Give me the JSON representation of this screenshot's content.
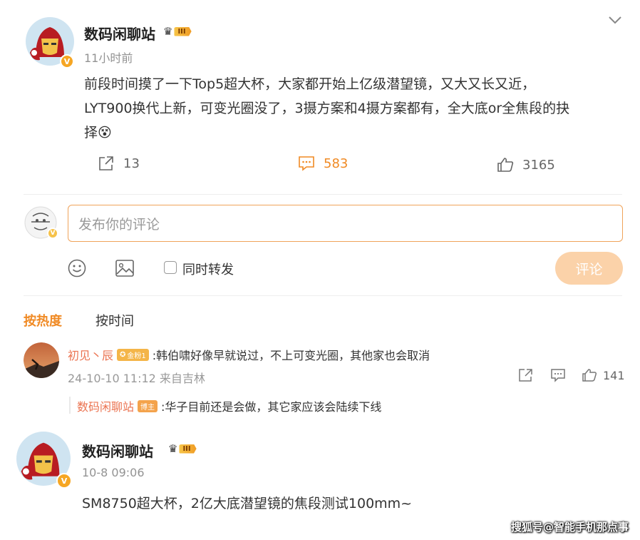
{
  "post1": {
    "author": "数码闲聊站",
    "level": "III",
    "time": "11小时前",
    "content_lines": [
      "前段时间摸了一下Top5超大杯，大家都开始上亿级潜望镜，又大又长又近，",
      "LYT900换代上新，可变光圈没了，3摄方案和4摄方案都有，全大底or全焦段的抉",
      "择😵"
    ],
    "share_count": "13",
    "comment_count": "583",
    "like_count": "3165"
  },
  "composer": {
    "placeholder": "发布你的评论",
    "repost_label": "同时转发",
    "submit_label": "评论"
  },
  "sort": {
    "hot_label": "按热度",
    "time_label": "按时间"
  },
  "comment1": {
    "author": "初见丶辰",
    "badge": "金粉1",
    "text": ":韩伯啸好像早就说过，不上可变光圈，其他家也会取消",
    "meta": "24-10-10 11:12 来自吉林",
    "like_count": "141",
    "reply": {
      "author": "数码闲聊站",
      "badge": "博主",
      "text": ":华子目前还是会做，其它家应该会陆续下线"
    }
  },
  "post2": {
    "author": "数码闲聊站",
    "level": "III",
    "time": "10-8 09:06",
    "content": "SM8750超大杯，2亿大底潜望镜的焦段测试100mm~"
  },
  "watermark": "搜狐号@智能手机那点事",
  "colors": {
    "accent": "#f08a24",
    "comment_name": "#eb7350",
    "submit_disabled": "#fbd2a9",
    "input_border": "#f0a35a"
  }
}
